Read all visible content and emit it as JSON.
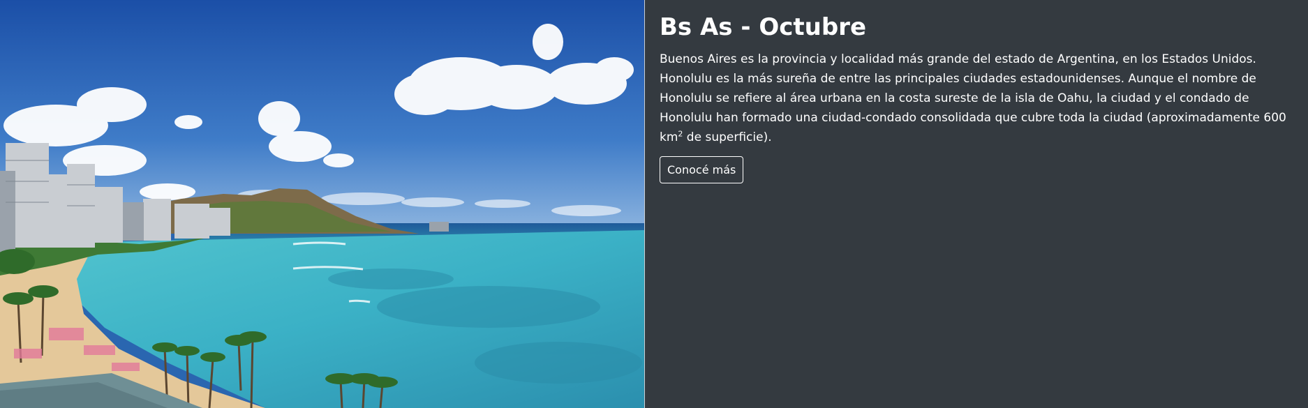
{
  "card": {
    "image_alt": "Waikiki beach and Diamond Head",
    "title": "Bs As - Octubre",
    "description_before_sup": "Buenos Aires es la provincia y localidad más grande del estado de Argentina, en los Estados Unidos. Honolulu es la más sureña de entre las principales ciudades estadounidenses. Aunque el nombre de Honolulu se refiere al área urbana en la costa sureste de la isla de Oahu, la ciudad y el condado de Honolulu han formado una ciudad-condado consolidada que cubre toda la ciudad (aproximadamente 600 km",
    "description_sup": "2",
    "description_after_sup": " de superficie).",
    "button_label": "Conocé más"
  },
  "colors": {
    "card_bg": "#343a40",
    "text": "#ffffff",
    "button_border": "#ffffff"
  }
}
